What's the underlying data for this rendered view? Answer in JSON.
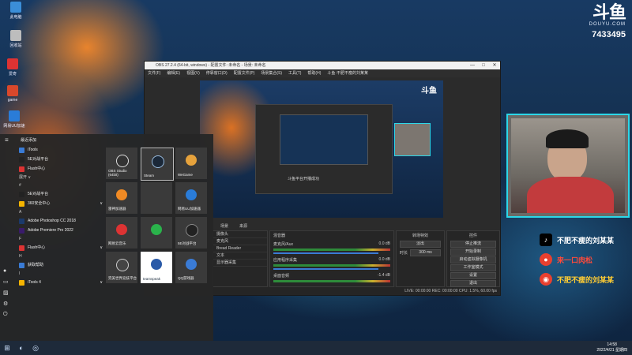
{
  "brand": {
    "logo": "斗鱼",
    "site": "DOUYU.COM",
    "room_id": "7433495"
  },
  "desktop_icons": [
    {
      "label": "此电脑",
      "color": "#3b8ed8"
    },
    {
      "label": "回收站",
      "color": "#bdbdbd"
    },
    {
      "label": "爱奇",
      "color": "#d33"
    },
    {
      "label": "game",
      "color": "#d9482b"
    },
    {
      "label": "网易UU加速",
      "color": "#2a7cd8"
    }
  ],
  "obs": {
    "title": "OBS 27.2.4 (64-bit, windows) - 配置文件: 未命名 - 场景: 未命名",
    "window_buttons": [
      "—",
      "□",
      "✕"
    ],
    "menu": [
      "文件(F)",
      "编辑(E)",
      "视图(V)",
      "停靠窗口(D)",
      "配置文件(P)",
      "场景集合(S)",
      "工具(T)",
      "帮助(H)",
      "斗鱼·不肥不瘦的刘某某"
    ],
    "panels": {
      "scenes": "场景",
      "sources": "来源",
      "mixer": "混音器",
      "transitions": "转场特效",
      "controls": "控件"
    },
    "sources": [
      "摄像头",
      "麦克风",
      "Bread Reader",
      "文本",
      "显示器采集"
    ],
    "mixer": [
      {
        "name": "麦克风/Aux",
        "db": "0.0 dB"
      },
      {
        "name": "应用程序采集",
        "db": "0.0 dB"
      },
      {
        "name": "桌面音频",
        "db": "-1.4 dB"
      }
    ],
    "transition": {
      "type": "淡出",
      "duration_label": "时长",
      "duration": "300 ms"
    },
    "controls": [
      "停止推流",
      "开始录制",
      "启动虚拟摄像机",
      "工作室模式",
      "设置",
      "退出"
    ],
    "status": "LIVE: 00:00:00   REC: 00:00:00   CPU: 1.5%, 60.00 fps",
    "preview_overlay": "斗鱼平台开播成功"
  },
  "start_menu": {
    "recent_label": "最近添加",
    "apps": [
      {
        "kind": "item",
        "label": "iTools",
        "color": "#3a7bd5"
      },
      {
        "kind": "item",
        "label": "5E对战平台",
        "color": "#222"
      },
      {
        "kind": "item",
        "label": "Flash中心",
        "color": "#d33"
      },
      {
        "kind": "letter",
        "label": "展开 ∨"
      },
      {
        "kind": "letter",
        "label": "#"
      },
      {
        "kind": "item",
        "label": "5E对战平台",
        "color": "#222"
      },
      {
        "kind": "item",
        "label": "360安全中心",
        "color": "#f5b400"
      },
      {
        "kind": "letter",
        "label": "A"
      },
      {
        "kind": "item",
        "label": "Adobe Photoshop CC 2018",
        "color": "#1b3a6b"
      },
      {
        "kind": "item",
        "label": "Adobe Premiere Pro 2022",
        "color": "#3a1b6b"
      },
      {
        "kind": "letter",
        "label": "F"
      },
      {
        "kind": "item",
        "label": "Flash中心",
        "color": "#d33"
      },
      {
        "kind": "letter",
        "label": "H"
      },
      {
        "kind": "item",
        "label": "获取帮助",
        "color": "#3a7bd5"
      },
      {
        "kind": "letter",
        "label": "I"
      },
      {
        "kind": "item",
        "label": "iTools 4",
        "color": "#f5b400"
      }
    ],
    "tiles": [
      {
        "label": "OBS Studio (64bit)",
        "color": "#333"
      },
      {
        "label": "Steam",
        "color": "#1b2838"
      },
      {
        "label": "WeGame",
        "color": "#e6a23c"
      },
      {
        "label": "雷神加速器",
        "color": "#f08a24"
      },
      {
        "label": "",
        "color": "#3a3a3a"
      },
      {
        "label": "网易UU加速器",
        "color": "#2a7cd8"
      },
      {
        "label": "网易云音乐",
        "color": "#d33"
      },
      {
        "label": "",
        "color": "#2ab34b"
      },
      {
        "label": "5E对战平台",
        "color": "#222"
      },
      {
        "label": "完美世界竞技平台",
        "color": "#444"
      },
      {
        "label": "teamspeak",
        "color": "#fff"
      },
      {
        "label": "QQ游戏器",
        "color": "#3a7bd5"
      }
    ]
  },
  "social": [
    {
      "icon": "tiktok-icon",
      "label": "不肥不瘦的刘某某",
      "color": "#000"
    },
    {
      "icon": "douyu-icon",
      "label": "来一口肉松",
      "color": "#e8402f"
    },
    {
      "icon": "weibo-icon",
      "label": "不肥不瘦的刘某某",
      "color": "#e8402f"
    }
  ],
  "clock": {
    "time": "14:58",
    "date": "2022/4/21 星期四"
  }
}
